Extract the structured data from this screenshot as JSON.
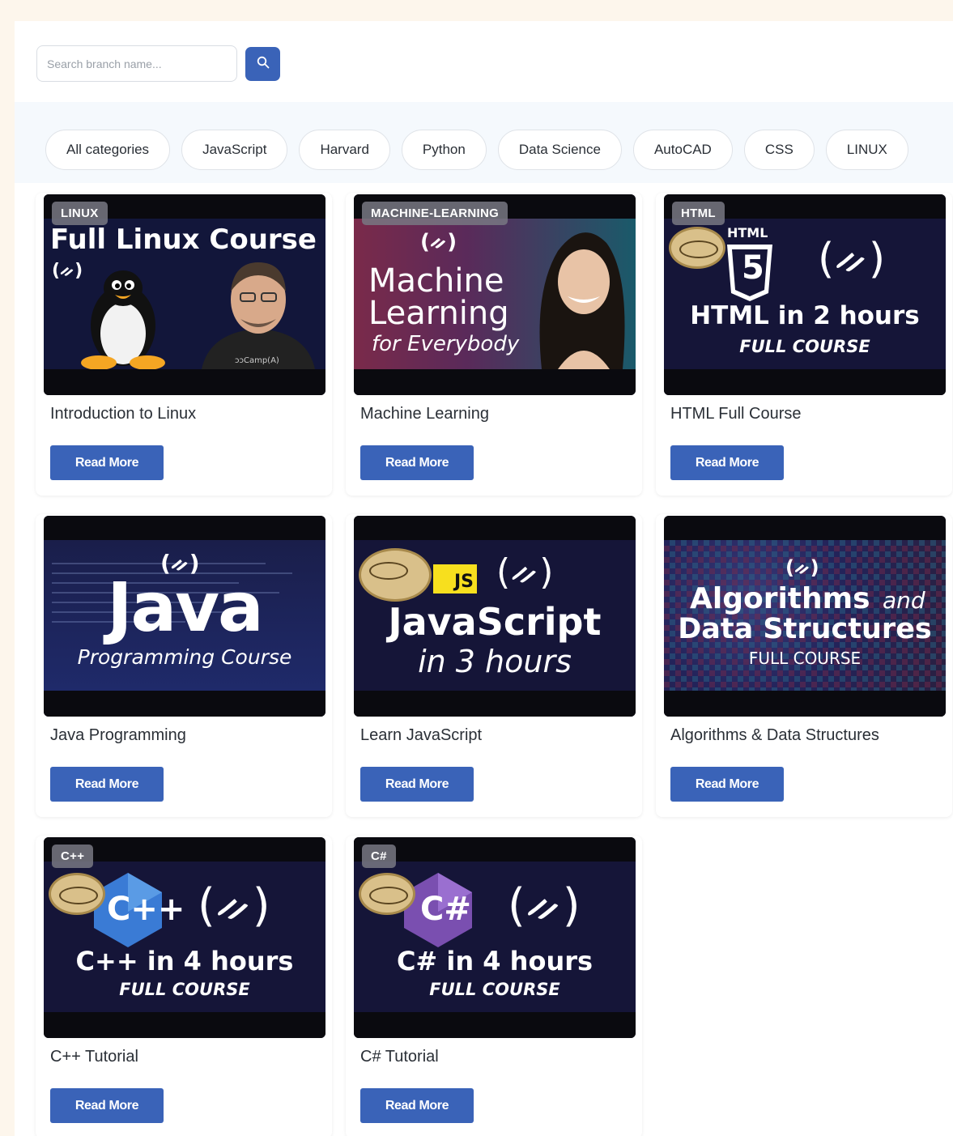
{
  "search": {
    "placeholder": "Search branch name...",
    "button_icon": "search-icon",
    "accent": "#3a63b8"
  },
  "categories": [
    "All categories",
    "JavaScript",
    "Harvard",
    "Python",
    "Data Science",
    "AutoCAD",
    "CSS",
    "LINUX"
  ],
  "courses": [
    {
      "badge": "LINUX",
      "title": "Introduction to Linux",
      "button": "Read More",
      "thumb_heading": "Full Linux Course",
      "thumb_logo": "(ᨀ)",
      "thumb_caption": "ɔɔCamp(A)"
    },
    {
      "badge": "MACHINE-LEARNING",
      "title": "Machine Learning",
      "button": "Read More",
      "thumb_logo": "(ᨀ)",
      "thumb_line1": "Machine",
      "thumb_line2": "Learning",
      "thumb_line3": "for Everybody"
    },
    {
      "badge": "HTML",
      "title": "HTML Full Course",
      "button": "Read More",
      "thumb_tag": "HTML",
      "thumb_shield": "5",
      "thumb_logo": "(ᨀ)",
      "thumb_heading": "HTML in 2 hours",
      "thumb_sub": "FULL COURSE"
    },
    {
      "title": "Java Programming",
      "button": "Read More",
      "thumb_logo": "(ᨀ)",
      "thumb_heading": "Java",
      "thumb_sub": "Programming Course"
    },
    {
      "title": "Learn JavaScript",
      "button": "Read More",
      "thumb_js": "JS",
      "thumb_logo": "(ᨀ)",
      "thumb_heading": "JavaScript",
      "thumb_sub": "in 3 hours"
    },
    {
      "title": "Algorithms & Data Structures",
      "button": "Read More",
      "thumb_logo": "(ᨀ)",
      "thumb_line1": "Algorithms",
      "thumb_and": "and",
      "thumb_line2": "Data Structures",
      "thumb_sub": "FULL COURSE"
    },
    {
      "badge": "C++",
      "title": "C++ Tutorial",
      "button": "Read More",
      "thumb_logo": "(ᨀ)",
      "thumb_icon_text": "C++",
      "thumb_heading": "C++ in 4 hours",
      "thumb_sub": "FULL COURSE"
    },
    {
      "badge": "C#",
      "title": "C# Tutorial",
      "button": "Read More",
      "thumb_logo": "(ᨀ)",
      "thumb_icon_text": "C#",
      "thumb_heading": "C# in 4 hours",
      "thumb_sub": "FULL COURSE"
    }
  ],
  "colors": {
    "page_bg": "#fdf6ec",
    "filter_bg": "#f5f9fd",
    "button_bg": "#3a63b8",
    "thumb_bg": "#17173a"
  }
}
